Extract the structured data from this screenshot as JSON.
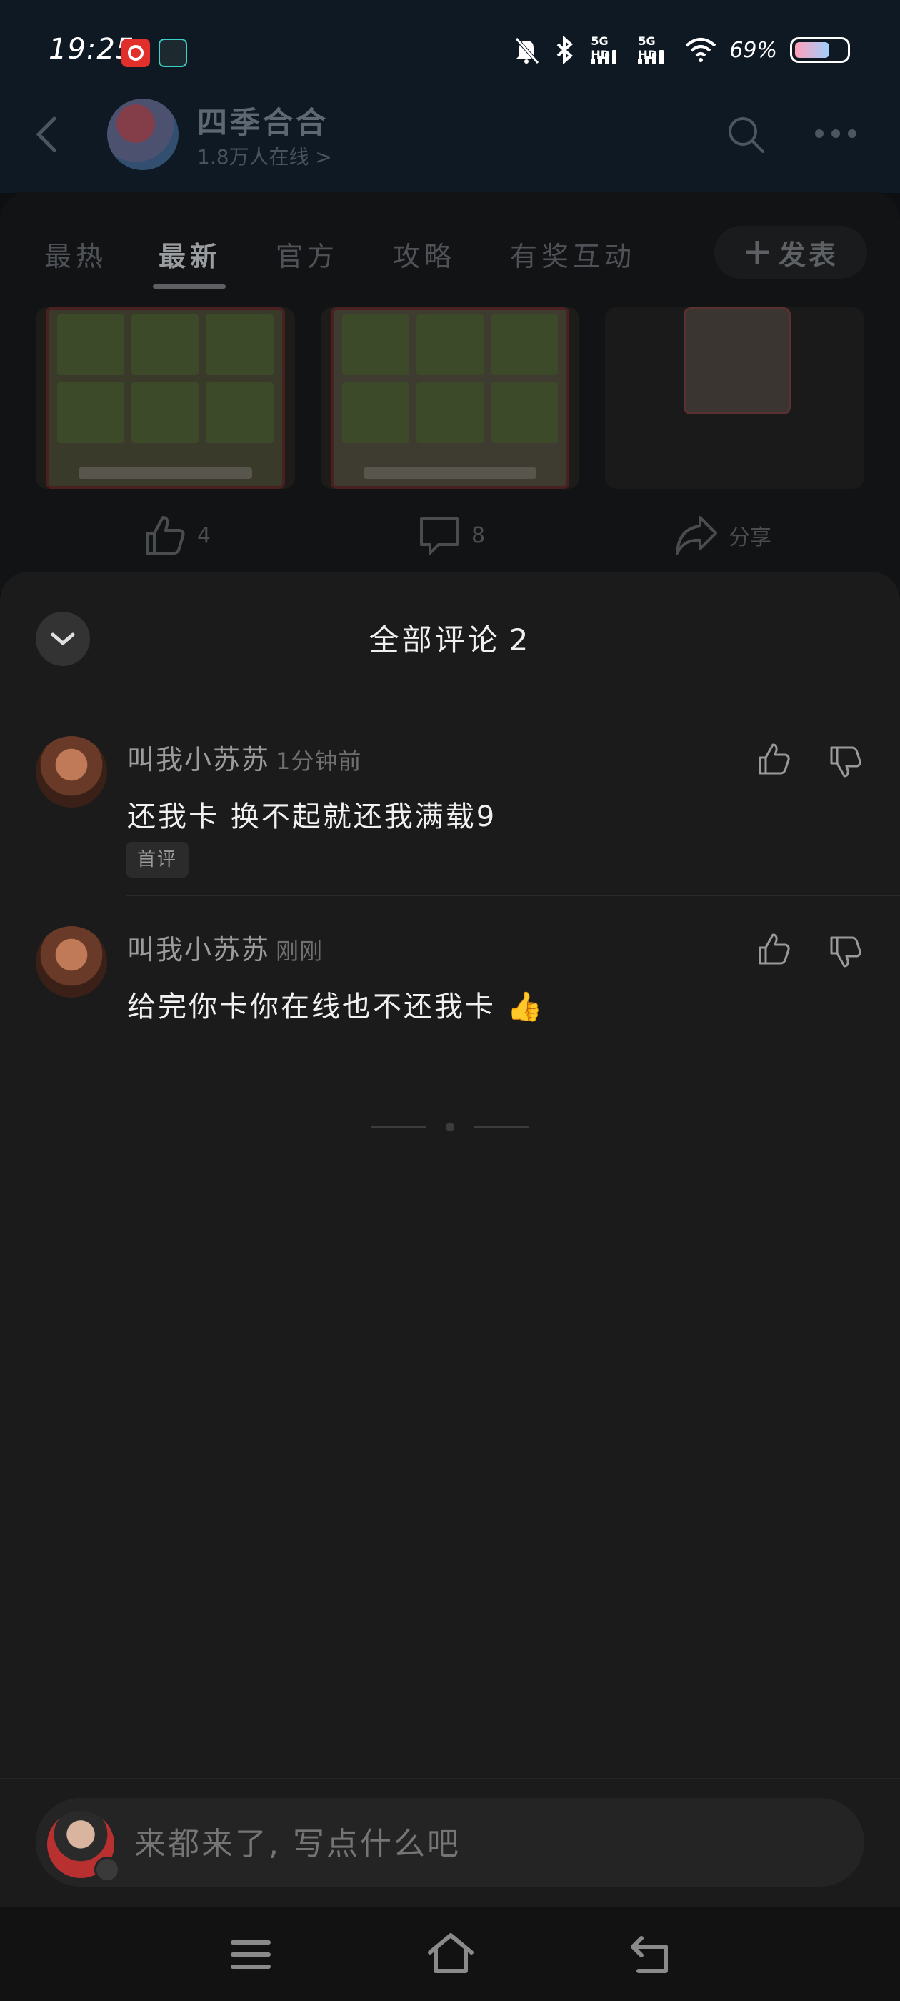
{
  "status_bar": {
    "time": "19:25",
    "signal_label_1": "5G HD",
    "signal_label_2": "5G HD",
    "battery_percent": "69%",
    "battery_level": 0.69
  },
  "header": {
    "title": "四季合合",
    "subtitle": "1.8万人在线 >"
  },
  "feed": {
    "tabs": [
      "最热",
      "最新",
      "官方",
      "攻略",
      "有奖互动"
    ],
    "active_tab": "最新",
    "post_button_label": "发表",
    "likes": "4",
    "comments": "8",
    "share_label": "分享"
  },
  "comments_sheet": {
    "title": "全部评论",
    "count": "2",
    "comments": [
      {
        "author": "叫我小苏苏",
        "time": "1分钟前",
        "text": "还我卡 换不起就还我满载9",
        "badge": "首评"
      },
      {
        "author": "叫我小苏苏",
        "time": "刚刚",
        "text": "给完你卡你在线也不还我卡 👍"
      }
    ]
  },
  "input": {
    "placeholder": "来都来了, 写点什么吧"
  },
  "colors": {
    "sheet_bg": "#1b1b1b",
    "text_primary": "#f0f0f0",
    "text_secondary": "#9b9b9b"
  }
}
